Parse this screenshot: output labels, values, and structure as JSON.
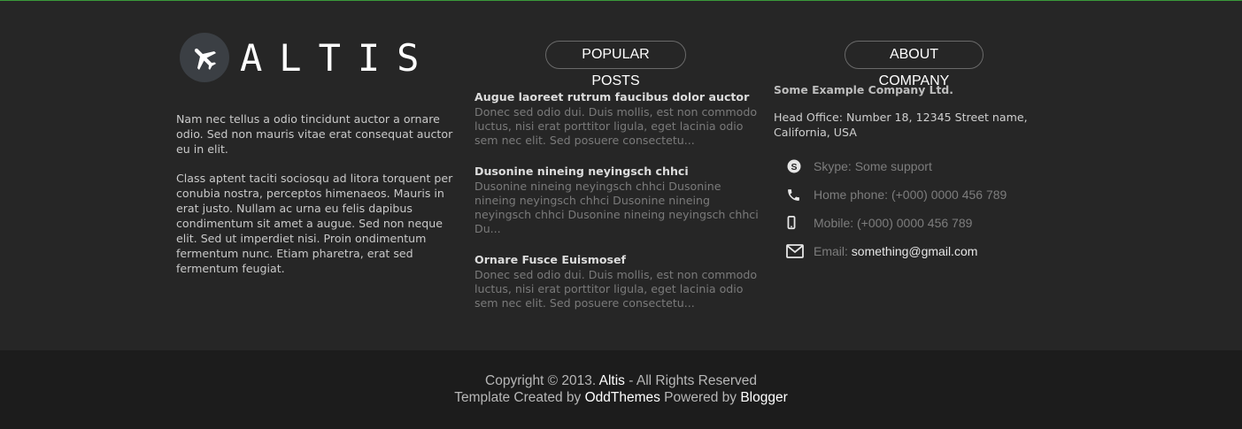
{
  "brand": {
    "logo_text": "ALTIS",
    "icon": "airplane-icon"
  },
  "about": {
    "paragraphs": [
      "Nam nec tellus a odio tincidunt auctor a ornare odio. Sed non mauris vitae erat consequat auctor eu in elit.",
      "Class aptent taciti sociosqu ad litora torquent per conubia nostra, perceptos himenaeos. Mauris in erat justo. Nullam ac urna eu felis dapibus condimentum sit amet a augue. Sed non neque elit. Sed ut imperdiet nisi. Proin ondimentum fermentum nunc. Etiam pharetra, erat sed fermentum feugiat."
    ]
  },
  "popular_posts": {
    "title": "POPULAR POSTS",
    "items": [
      {
        "title": "Augue laoreet rutrum faucibus dolor auctor",
        "excerpt": "Donec sed odio dui. Duis mollis, est non commodo luctus, nisi erat porttitor ligula, eget lacinia odio sem nec elit. Sed posuere consectetu..."
      },
      {
        "title": "Dusonine nineing neyingsch chhci",
        "excerpt": "Dusonine nineing neyingsch chhci Dusonine nineing neyingsch chhci Dusonine nineing neyingsch chhci Dusonine nineing neyingsch chhci Du..."
      },
      {
        "title": "Ornare Fusce Euismosef",
        "excerpt": "Donec sed odio dui. Duis mollis, est non commodo luctus, nisi erat porttitor ligula, eget lacinia odio sem nec elit. Sed posuere consectetu..."
      }
    ]
  },
  "about_company": {
    "title": "ABOUT COMPANY",
    "company_name": "Some Example Company Ltd.",
    "office": "Head Office: Number 18, 12345 Street name, California, USA",
    "contacts": [
      {
        "icon": "skype-icon",
        "label": "Skype: Some support",
        "value": ""
      },
      {
        "icon": "phone-icon",
        "label": "Home phone: (+000) 0000 456 789",
        "value": ""
      },
      {
        "icon": "mobile-icon",
        "label": "Mobile: (+000) 0000 456 789",
        "value": ""
      },
      {
        "icon": "envelope-icon",
        "label": "Email: ",
        "value": "something@gmail.com"
      }
    ]
  },
  "footer": {
    "copyright_prefix": "Copyright © 2013. ",
    "brand_link": "Altis",
    "copyright_suffix": " - All Rights Reserved",
    "created_prefix": "Template Created by ",
    "created_link": "OddThemes",
    "powered_prefix": " Powered by ",
    "powered_link": "Blogger"
  },
  "colors": {
    "background": "#262626",
    "footer_bottom": "#1c1c1c",
    "top_accent": "#3a9a3a",
    "logo_circle": "#3b3f44"
  }
}
